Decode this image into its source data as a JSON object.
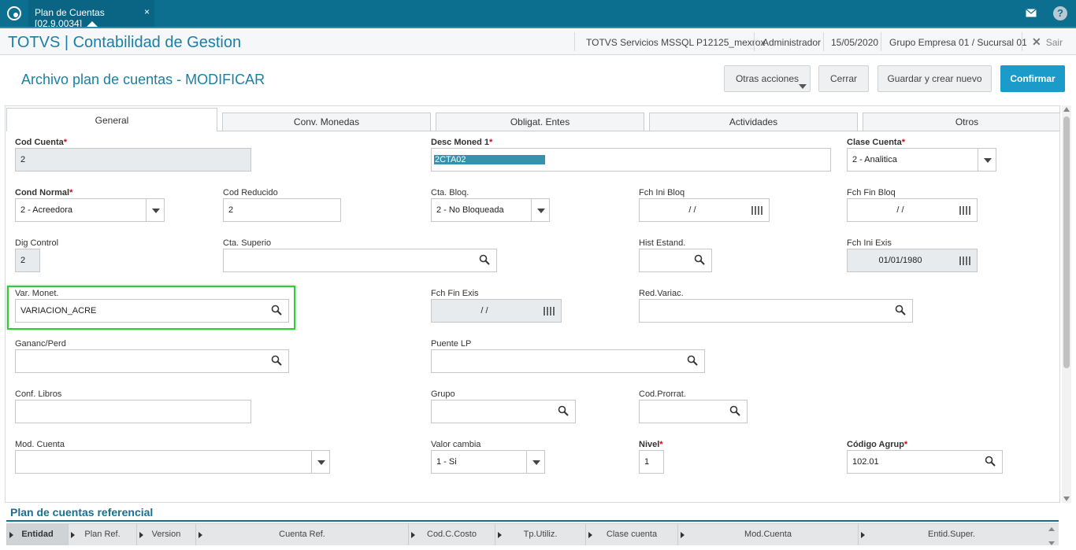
{
  "window": {
    "tab_title": "Plan de Cuentas [02.9.0034]",
    "tab_close": "×"
  },
  "app": {
    "title": "TOTVS | Contabilidad de Gestion",
    "environment": "TOTVS Servicios MSSQL P12125_mexrox",
    "user": "Administrador",
    "date": "15/05/2020",
    "company": "Grupo Empresa 01 / Sucursal 01",
    "exit_label": "Sair"
  },
  "page": {
    "title": "Archivo plan de cuentas - MODIFICAR",
    "buttons": {
      "other_actions": "Otras acciones",
      "close": "Cerrar",
      "save_new": "Guardar y crear nuevo",
      "confirm": "Confirmar"
    }
  },
  "tabs": [
    "General",
    "Conv. Monedas",
    "Obligat. Entes",
    "Actividades",
    "Otros"
  ],
  "fields": {
    "cod_cuenta": {
      "label": "Cod Cuenta",
      "value": "2"
    },
    "desc_moned1": {
      "label": "Desc Moned 1",
      "value": "2CTA02"
    },
    "clase_cuenta": {
      "label": "Clase Cuenta",
      "value": "2 - Analitica"
    },
    "cond_normal": {
      "label": "Cond Normal",
      "value": "2 - Acreedora"
    },
    "cod_reducido": {
      "label": "Cod Reducido",
      "value": "2"
    },
    "cta_bloq": {
      "label": "Cta. Bloq.",
      "value": "2 - No Bloqueada"
    },
    "fch_ini_bloq": {
      "label": "Fch Ini Bloq",
      "value": "/ /"
    },
    "fch_fin_bloq": {
      "label": "Fch Fin Bloq",
      "value": "/ /"
    },
    "dig_control": {
      "label": "Dig Control",
      "value": "2"
    },
    "cta_superio": {
      "label": "Cta. Superio",
      "value": ""
    },
    "hist_estand": {
      "label": "Hist Estand.",
      "value": ""
    },
    "fch_ini_exis": {
      "label": "Fch Ini Exis",
      "value": "01/01/1980"
    },
    "var_monet": {
      "label": "Var. Monet.",
      "value": "VARIACION_ACRE"
    },
    "fch_fin_exis": {
      "label": "Fch Fin Exis",
      "value": "/ /"
    },
    "red_variac": {
      "label": "Red.Variac.",
      "value": ""
    },
    "gananc_perd": {
      "label": "Gananc/Perd",
      "value": ""
    },
    "puente_lp": {
      "label": "Puente LP",
      "value": ""
    },
    "conf_libros": {
      "label": "Conf. Libros",
      "value": ""
    },
    "grupo": {
      "label": "Grupo",
      "value": ""
    },
    "cod_prorrat": {
      "label": "Cod.Prorrat.",
      "value": ""
    },
    "mod_cuenta": {
      "label": "Mod. Cuenta",
      "value": ""
    },
    "valor_cambia": {
      "label": "Valor cambia",
      "value": "1 - Si"
    },
    "nivel": {
      "label": "Nivel",
      "value": "1"
    },
    "codigo_agrup": {
      "label": "Código Agrup",
      "value": "102.01"
    }
  },
  "required_marker": "*",
  "grid": {
    "title": "Plan de cuentas referencial",
    "columns": [
      "Entidad",
      "Plan Ref.",
      "Version",
      "Cuenta Ref.",
      "Cod.C.Costo",
      "Tp.Utiliz.",
      "Clase cuenta",
      "Mod.Cuenta",
      "Entid.Super."
    ]
  },
  "colors": {
    "top_bar": "#0c6f8f",
    "accent": "#1a7fa6",
    "primary_button": "#1a9bc9",
    "highlight": "#37c93a",
    "required": "#d0021b"
  }
}
